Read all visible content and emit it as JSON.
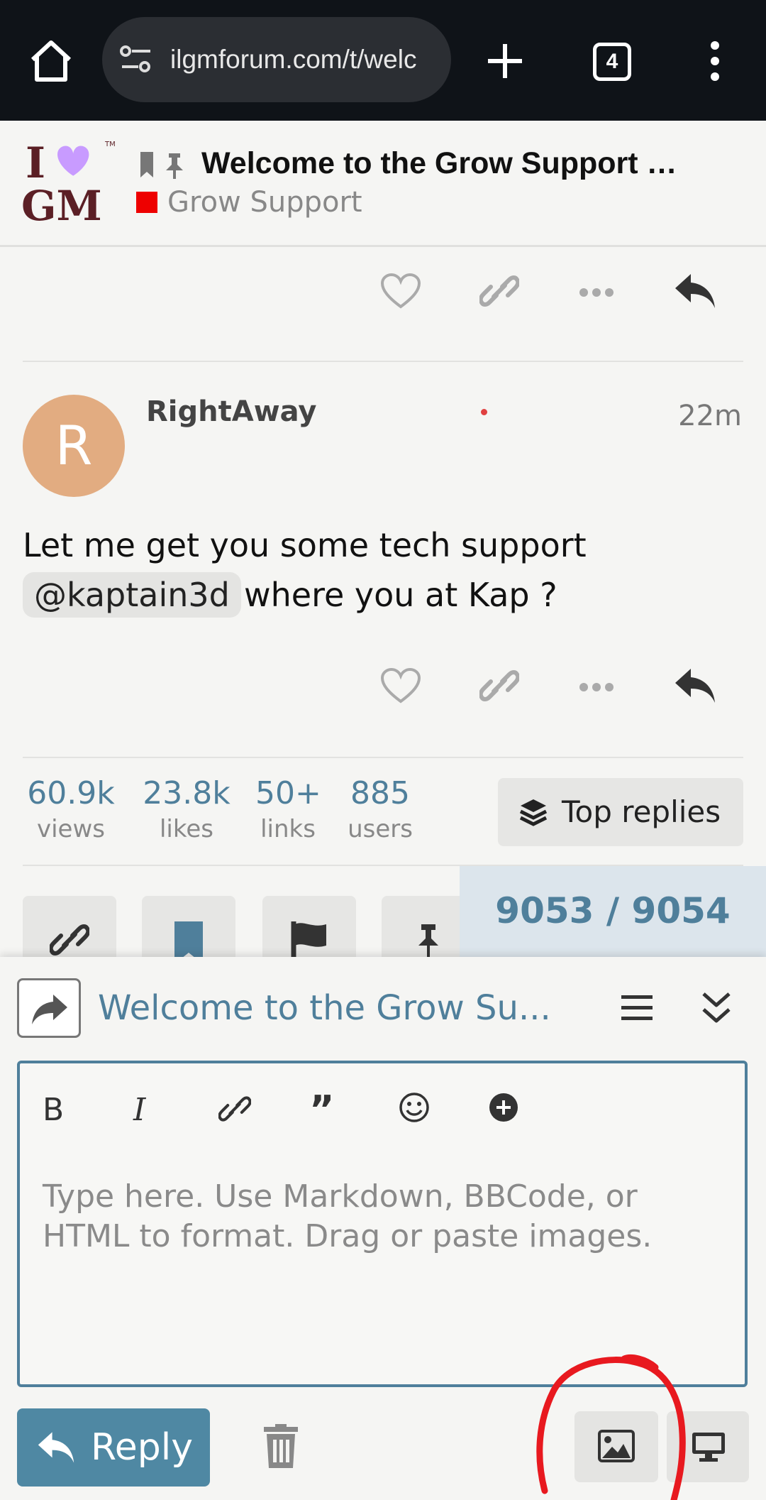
{
  "browser": {
    "url": "ilgmforum.com/t/welc",
    "tab_count": "4"
  },
  "header": {
    "logo_text": "I♥GM",
    "topic_title": "Welcome to the Grow Support …",
    "category": "Grow Support",
    "category_color": "#ee0000"
  },
  "post": {
    "username": "RightAway",
    "avatar_letter": "R",
    "avatar_color": "#e2ac81",
    "time": "22m",
    "line1": "Let me get you some tech support",
    "mention": "@kaptain3d",
    "line2": "where you at Kap ?"
  },
  "stats": {
    "views_num": "60.9k",
    "views_label": "views",
    "likes_num": "23.8k",
    "likes_label": "likes",
    "links_num": "50+",
    "links_label": "links",
    "users_num": "885",
    "users_label": "users",
    "top_replies": "Top replies"
  },
  "progress": {
    "text": "9053 / 9054"
  },
  "composer": {
    "reply_title": "Welcome to the Grow Su...",
    "placeholder": "Type here. Use Markdown, BBCode, or HTML to format. Drag or paste images.",
    "reply_label": "Reply"
  },
  "colors": {
    "accent": "#4f7f9b",
    "reply_button": "#4f88a3",
    "annotation": "#e8191f"
  },
  "icons": [
    "home-icon",
    "tune-icon",
    "plus-icon",
    "more-vert-icon",
    "bookmark-icon",
    "pin-icon",
    "heart-icon",
    "link-icon",
    "ellipsis-icon",
    "reply-icon",
    "layers-icon",
    "flag-icon",
    "share-icon",
    "menu-icon",
    "collapse-icon",
    "bold-icon",
    "italic-icon",
    "quote-icon",
    "emoji-icon",
    "add-circle-icon",
    "trash-icon",
    "image-icon",
    "desktop-icon"
  ]
}
